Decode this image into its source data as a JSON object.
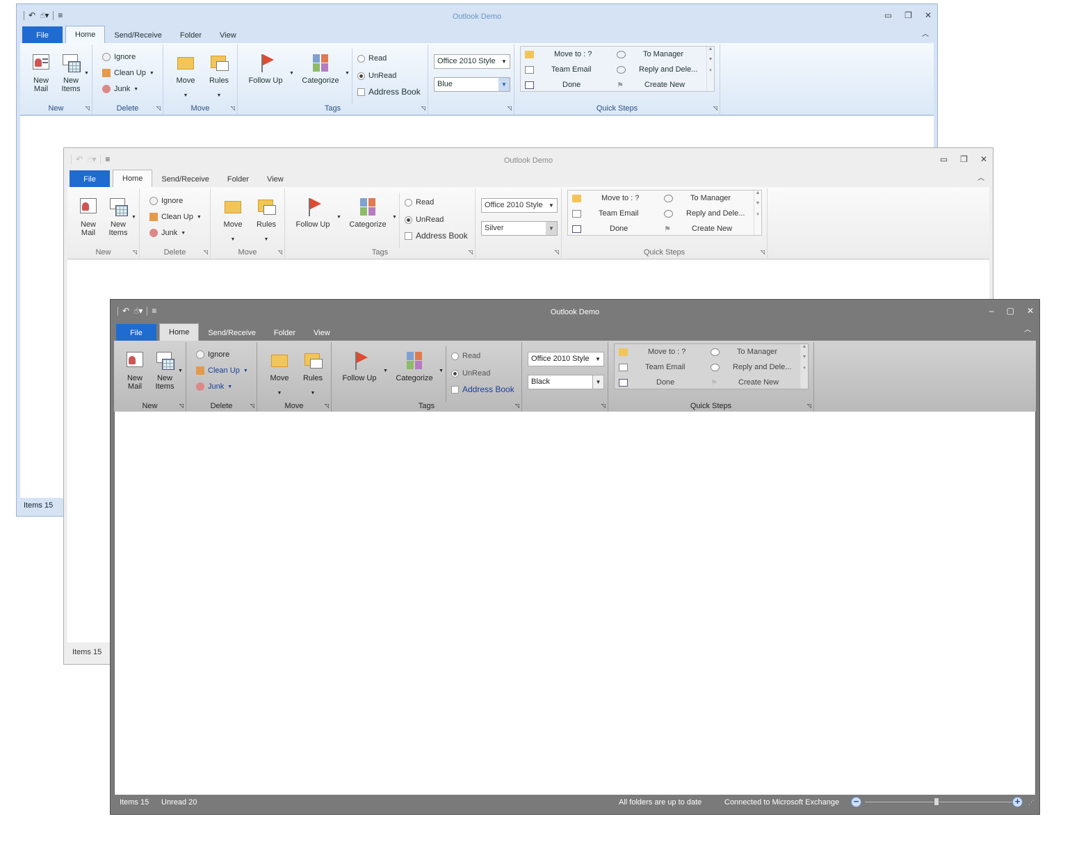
{
  "app_title": "Outlook Demo",
  "tabs": {
    "file": "File",
    "home": "Home",
    "send_receive": "Send/Receive",
    "folder": "Folder",
    "view": "View"
  },
  "groups": {
    "new": "New",
    "delete": "Delete",
    "move": "Move",
    "tags": "Tags",
    "quick_steps": "Quick Steps"
  },
  "buttons": {
    "new_mail": "New Mail",
    "new_items": "New Items",
    "ignore": "Ignore",
    "clean_up": "Clean Up",
    "junk": "Junk",
    "move": "Move",
    "rules": "Rules",
    "follow_up": "Follow Up",
    "categorize": "Categorize",
    "read": "Read",
    "unread": "UnRead",
    "address_book": "Address Book"
  },
  "style_combo": "Office 2010 Style",
  "quick_steps": {
    "move_to": "Move to : ?",
    "team_email": "Team Email",
    "done": "Done",
    "to_manager": "To Manager",
    "reply_delete": "Reply and Dele...",
    "create_new": "Create New"
  },
  "windows": {
    "blue": {
      "theme": "Blue",
      "status_items": "Items 15"
    },
    "silver": {
      "theme": "Silver",
      "status_items": "Items 15"
    },
    "black": {
      "theme": "Black",
      "status_items": "Items 15",
      "status_unread": "Unread 20",
      "status_folders": "All folders are up to date",
      "status_connection": "Connected to Microsoft Exchange"
    }
  },
  "colors": {
    "file_tab": "#1f6bd0",
    "blue_theme": "#d5e3f5",
    "silver_theme": "#eeeeee",
    "black_theme": "#7a7a7a",
    "flag": "#e04a2f"
  }
}
